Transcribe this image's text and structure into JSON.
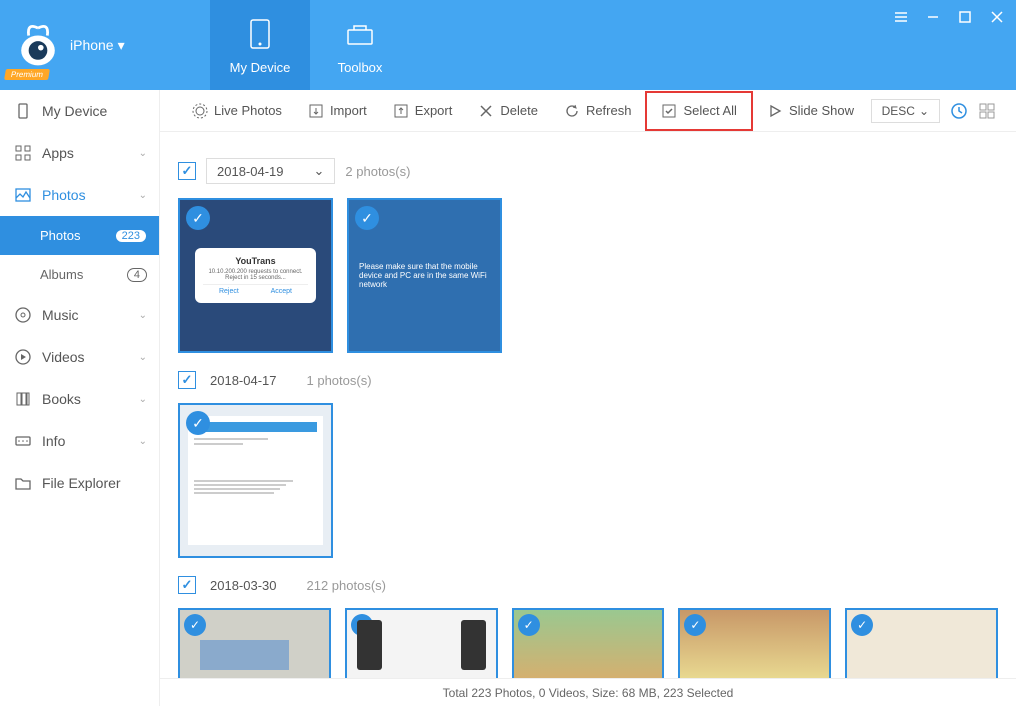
{
  "header": {
    "device_label": "iPhone",
    "premium_badge": "Premium",
    "tabs": [
      {
        "label": "My Device",
        "active": true
      },
      {
        "label": "Toolbox",
        "active": false
      }
    ]
  },
  "sidebar": {
    "items": [
      {
        "label": "My Device",
        "icon": "device-icon"
      },
      {
        "label": "Apps",
        "icon": "apps-icon",
        "expandable": true
      },
      {
        "label": "Photos",
        "icon": "photos-icon",
        "active": true,
        "expandable": true
      },
      {
        "label": "Photos",
        "sub": true,
        "selected": true,
        "badge": "223"
      },
      {
        "label": "Albums",
        "sub": true,
        "badge": "4"
      },
      {
        "label": "Music",
        "icon": "music-icon",
        "expandable": true
      },
      {
        "label": "Videos",
        "icon": "videos-icon",
        "expandable": true
      },
      {
        "label": "Books",
        "icon": "books-icon",
        "expandable": true
      },
      {
        "label": "Info",
        "icon": "info-icon",
        "expandable": true
      },
      {
        "label": "File Explorer",
        "icon": "folder-icon"
      }
    ]
  },
  "toolbar": {
    "buttons": [
      {
        "label": "Live Photos",
        "icon": "live-icon"
      },
      {
        "label": "Import",
        "icon": "import-icon"
      },
      {
        "label": "Export",
        "icon": "export-icon"
      },
      {
        "label": "Delete",
        "icon": "delete-icon"
      },
      {
        "label": "Refresh",
        "icon": "refresh-icon"
      },
      {
        "label": "Select All",
        "icon": "select-all-icon",
        "highlighted": true
      },
      {
        "label": "Slide Show",
        "icon": "play-icon"
      }
    ],
    "sort_label": "DESC"
  },
  "groups": [
    {
      "date": "2018-04-19",
      "count_label": "2 photos(s)",
      "show_select": true,
      "photo_count": 2
    },
    {
      "date": "2018-04-17",
      "count_label": "1 photos(s)",
      "show_select": false,
      "photo_count": 1
    },
    {
      "date": "2018-03-30",
      "count_label": "212 photos(s)",
      "show_select": false,
      "photo_count": 5
    }
  ],
  "status_text": "Total 223 Photos, 0 Videos, Size: 68 MB, 223 Selected",
  "mock": {
    "dialog1_title": "YouTrans",
    "dialog1_text": "10.10.200.200 requests to connect. Reject in 15 seconds...",
    "dialog1_reject": "Reject",
    "dialog1_accept": "Accept",
    "dialog2_text": "Please make sure that the mobile device and PC are in the same WiFi network"
  }
}
